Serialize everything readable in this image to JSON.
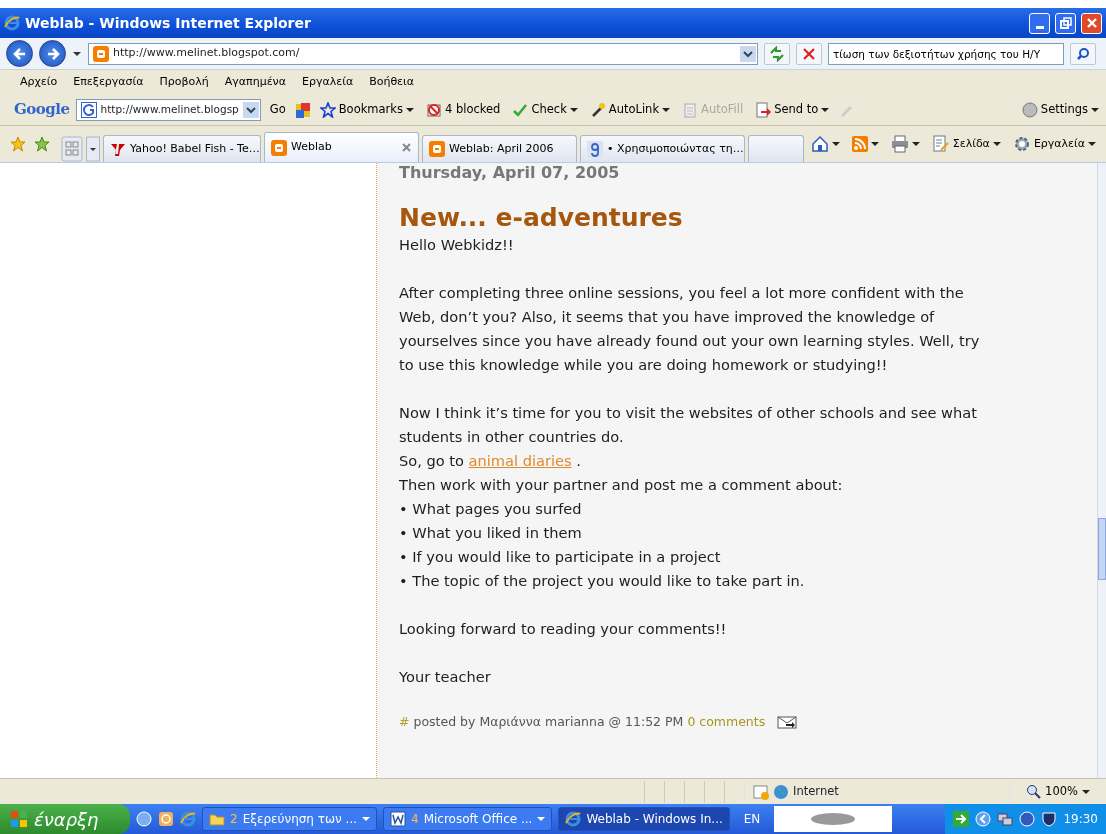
{
  "window": {
    "title": "Weblab - Windows Internet Explorer"
  },
  "address": {
    "url": "http://www.melinet.blogspot.com/"
  },
  "search": {
    "value": "τίωση των δεξιοτήτων χρήσης του Η/Υ"
  },
  "menu": [
    "Αρχείο",
    "Επεξεργασία",
    "Προβολή",
    "Αγαπημένα",
    "Εργαλεία",
    "Βοήθεια"
  ],
  "google_toolbar": {
    "logo": "Google",
    "field": "http://www.melinet.blogsp",
    "go": "Go",
    "items": [
      {
        "kind": "bookmarks",
        "label": "Bookmarks",
        "disabled": false
      },
      {
        "kind": "blocked",
        "label": "4 blocked",
        "disabled": false
      },
      {
        "kind": "check",
        "label": "Check",
        "disabled": false
      },
      {
        "kind": "autolink",
        "label": "AutoLink",
        "disabled": false
      },
      {
        "kind": "autofill",
        "label": "AutoFill",
        "disabled": true
      },
      {
        "kind": "sendto",
        "label": "Send to",
        "disabled": false
      }
    ],
    "settings": "Settings"
  },
  "tabs": [
    {
      "kind": "yahoo",
      "label": "Yahoo! Babel Fish - Te…",
      "selected": false
    },
    {
      "kind": "blogger",
      "label": "Weblab",
      "selected": true
    },
    {
      "kind": "blogger",
      "label": "Weblab: April 2006",
      "selected": false
    },
    {
      "kind": "google",
      "label": "• Χρησιμοποιώντας τη…",
      "selected": false
    },
    {
      "kind": "new",
      "selected": false
    }
  ],
  "command_bar": [
    "Σελίδα",
    "Εργαλεία"
  ],
  "post": {
    "date": "Thursday, April 07, 2005",
    "title": "New... e-adventures",
    "blocks": [
      {
        "kind": "para",
        "text": "Hello Webkidz!!"
      },
      {
        "kind": "para",
        "text": "After completing three online sessions, you feel a lot more confident with the Web, don’t you? Also, it seems that you have improved the knowledge of yourselves since you have already found out your own learning styles. Well, try to use this knowledge while you are doing homework or studying!!"
      },
      {
        "kind": "line",
        "text": "Now I think it’s time for you to visit the websites of other schools and see what students in other countries do."
      },
      {
        "kind": "link",
        "before": "So, go to ",
        "link": "animal diaries",
        "after": " ."
      },
      {
        "kind": "line",
        "text": "Then work with your partner and post me a comment about:"
      },
      {
        "kind": "line",
        "text": "• What pages you surfed"
      },
      {
        "kind": "line",
        "text": "• What you liked in them"
      },
      {
        "kind": "line",
        "text": "• If you would like to participate in a project"
      },
      {
        "kind": "para",
        "text": "• The topic of the project you would like to take part in."
      },
      {
        "kind": "para",
        "text": "Looking forward to reading your comments!!"
      },
      {
        "kind": "para",
        "text": "Your teacher"
      }
    ],
    "footer": {
      "hash": "#",
      "byline": "posted by Μαριάννα marianna @ 11:52 PM",
      "comments": "0 comments"
    }
  },
  "status_bar": {
    "zone": "Internet",
    "zoom": "100%"
  },
  "taskbar": {
    "start": "έναρξη",
    "tasks": [
      {
        "count": "2",
        "label": "Εξερεύνηση των ...",
        "kind": "folder",
        "selected": false
      },
      {
        "count": "4",
        "label": "Microsoft Office ...",
        "kind": "word",
        "selected": false
      },
      {
        "label": "Weblab - Windows In...",
        "kind": "ie",
        "selected": true
      }
    ],
    "language": "EN",
    "clock": "19:30"
  }
}
